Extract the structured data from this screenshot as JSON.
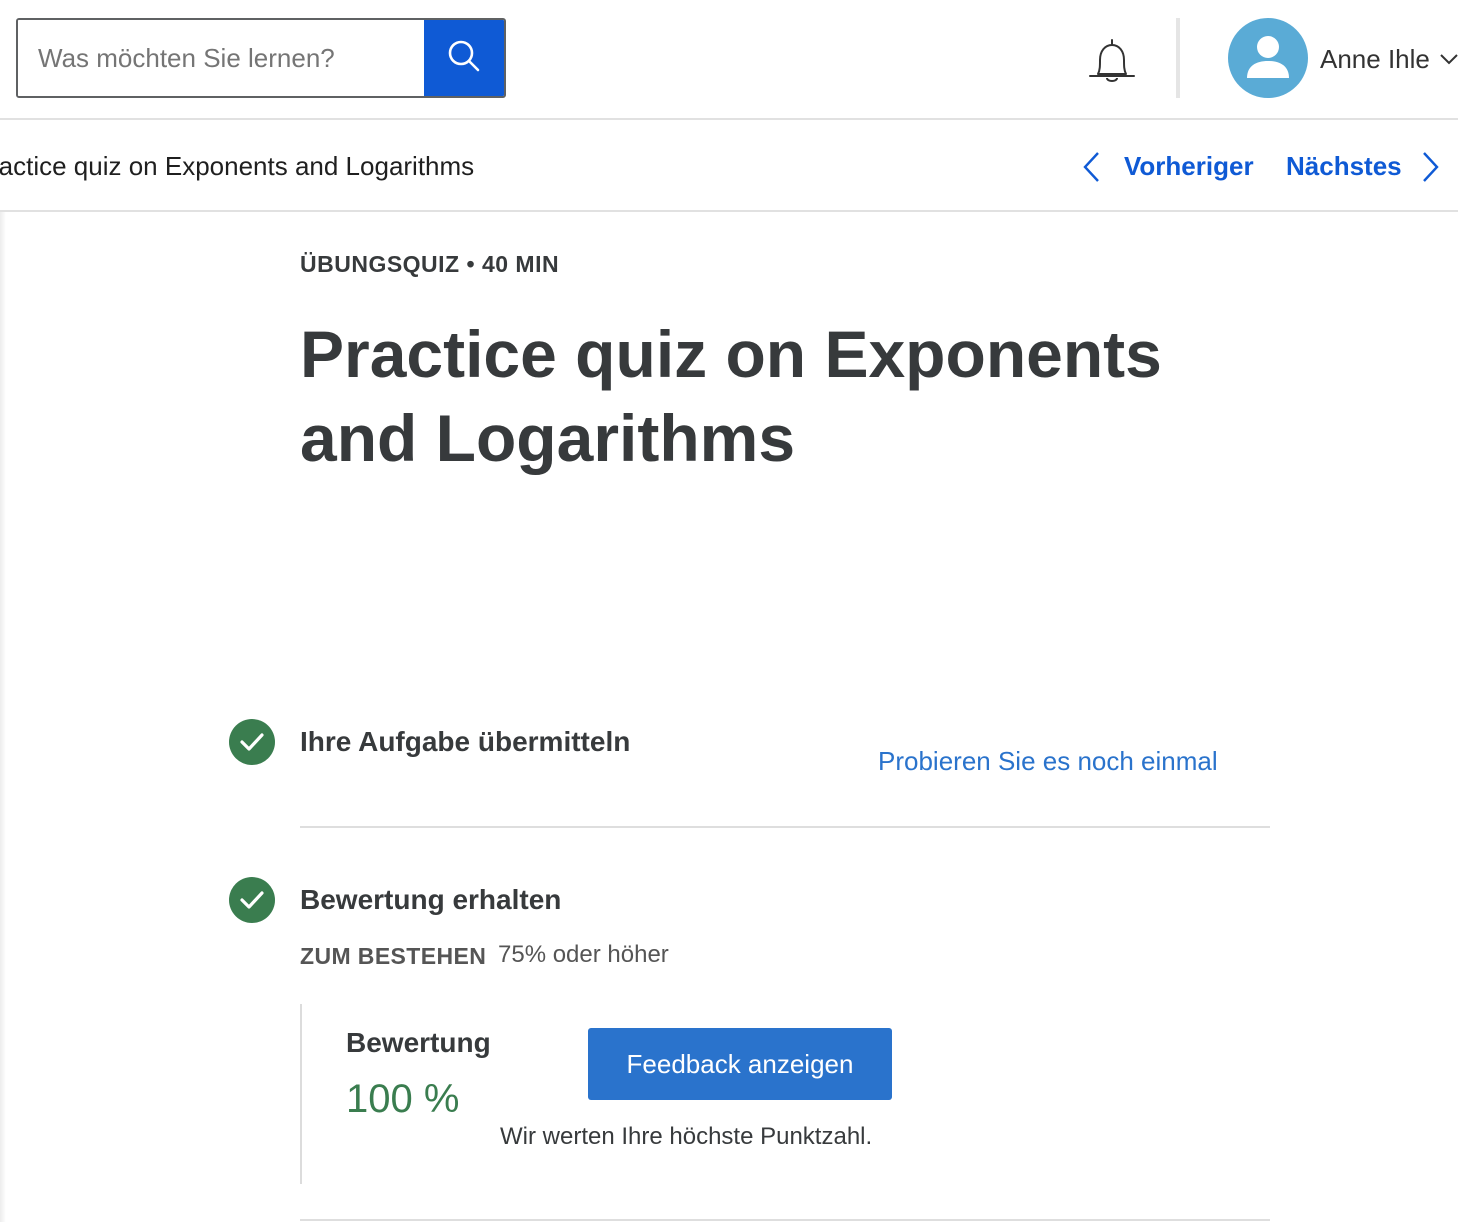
{
  "header": {
    "search": {
      "placeholder": "Was möchten Sie lernen?",
      "value": ""
    },
    "icons": {
      "search": "search-icon",
      "notifications": "bell-icon",
      "avatar": "user-icon",
      "dropdown": "chevron-down-icon"
    },
    "user": {
      "name": "Anne Ihle"
    }
  },
  "nav": {
    "breadcrumb": "ractice quiz on Exponents and Logarithms",
    "prev_label": "Vorheriger",
    "next_label": "Nächstes"
  },
  "main": {
    "meta": "ÜBUNGSQUIZ • 40 MIN",
    "title": "Practice quiz on Exponents and Logarithms",
    "steps": [
      {
        "title": "Ihre Aufgabe übermitteln",
        "action": "Probieren Sie es noch einmal"
      },
      {
        "title": "Bewertung erhalten"
      }
    ],
    "pass": {
      "label": "ZUM BESTEHEN",
      "value": "75% oder höher"
    },
    "grade": {
      "label": "Bewertung",
      "value": "100 %",
      "button": "Feedback anzeigen",
      "note": "Wir werten Ihre höchste Punktzahl."
    }
  },
  "colors": {
    "primary_blue": "#0f5ad5",
    "link_blue": "#2a73cc",
    "success_green": "#3a7d4f",
    "avatar_blue": "#5aabd6",
    "text_dark": "#373a3c"
  }
}
